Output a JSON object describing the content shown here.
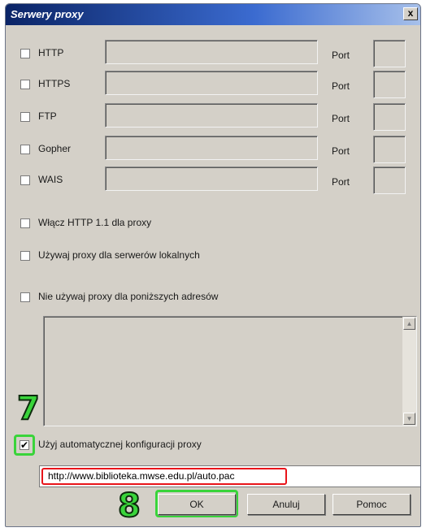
{
  "window": {
    "title": "Serwery proxy",
    "close_label": "x"
  },
  "proxies": [
    {
      "label": "HTTP",
      "port_label": "Port",
      "checked": false
    },
    {
      "label": "HTTPS",
      "port_label": "Port",
      "checked": false
    },
    {
      "label": "FTP",
      "port_label": "Port",
      "checked": false
    },
    {
      "label": "Gopher",
      "port_label": "Port",
      "checked": false
    },
    {
      "label": "WAIS",
      "port_label": "Port",
      "checked": false
    }
  ],
  "options": {
    "http11": "Włącz HTTP 1.1 dla proxy",
    "local": "Używaj proxy dla serwerów lokalnych",
    "bypass": "Nie używaj proxy dla poniższych adresów"
  },
  "auto_config": {
    "label": "Użyj automatycznej konfiguracji proxy",
    "checked": true,
    "checkmark": "✔",
    "url": "http://www.biblioteka.mwse.edu.pl/auto.pac"
  },
  "buttons": {
    "ok": "OK",
    "cancel": "Anuluj",
    "help": "Pomoc"
  },
  "annotations": {
    "step7": "7",
    "step8": "8",
    "highlight_green": "#39d43a",
    "highlight_red": "#e8141a"
  },
  "scroll": {
    "up": "▲",
    "down": "▼"
  }
}
